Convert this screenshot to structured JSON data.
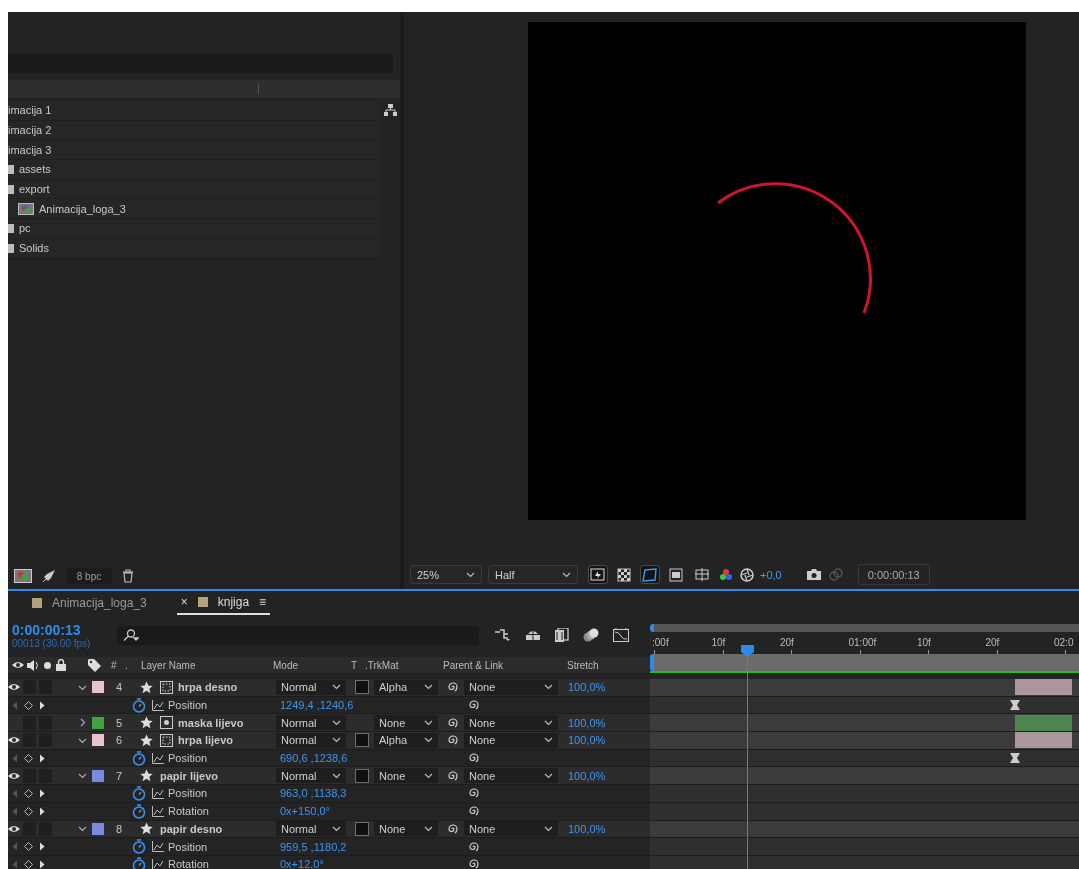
{
  "project": {
    "items": [
      {
        "label": "imacija 1",
        "kind": "plain"
      },
      {
        "label": "imacija 2",
        "kind": "plain"
      },
      {
        "label": "imacija 3",
        "kind": "plain"
      },
      {
        "label": "assets",
        "kind": "folder"
      },
      {
        "label": "export",
        "kind": "folder",
        "children": [
          {
            "label": "Animacija_loga_3",
            "kind": "composition"
          }
        ]
      },
      {
        "label": "pc",
        "kind": "folder"
      },
      {
        "label": "Solids",
        "kind": "folder"
      }
    ],
    "bit_depth": "8 bpc"
  },
  "viewer": {
    "zoom": "25%",
    "resolution": "Half",
    "exposure": "+0,0",
    "timecode": "0:00:00:13",
    "toggles": [
      {
        "kind": "fast-previews",
        "on": true
      },
      {
        "kind": "transparency-grid",
        "on": false
      },
      {
        "kind": "mask-path",
        "on": true
      },
      {
        "kind": "region-of-interest",
        "on": false
      },
      {
        "kind": "guides",
        "on": false
      }
    ]
  },
  "timeline": {
    "tabs": [
      {
        "label": "Animacija_loga_3",
        "color": "#b5a07c",
        "selected": false
      },
      {
        "close": "×",
        "label": "knjiga",
        "color": "#b5a07c",
        "selected": true,
        "menu": "≡"
      }
    ],
    "current_time": "0:00:00:13",
    "frame_info": "00013 (30.00 fps)",
    "columns": [
      "#",
      ".",
      "Layer Name",
      "Mode",
      "T",
      ".TrkMat",
      "Parent & Link",
      "Stretch"
    ],
    "ruler": [
      ":00f",
      "10f",
      "20f",
      "01:00f",
      "10f",
      "20f",
      "02:0"
    ],
    "layers": [
      {
        "number": "4",
        "name": "hrpa desno",
        "color": "#e8c2cf",
        "visible": true,
        "expanded": true,
        "kind": "shape",
        "mode": "Normal",
        "matte_box": true,
        "trkmat": "Alpha",
        "parent": "None",
        "stretch": "100,0%",
        "bar_visible": true,
        "properties": [
          {
            "name": "Position",
            "value": "1249,4 ,1240,6",
            "keyframe": true
          }
        ]
      },
      {
        "number": "5",
        "name": "maska lijevo",
        "color": "#3fa33f",
        "visible": false,
        "expanded": false,
        "kind": "mask",
        "mode": "Normal",
        "matte_box": false,
        "trkmat": "None",
        "parent": "None",
        "stretch": "100,0%",
        "bar_visible": true
      },
      {
        "number": "6",
        "name": "hrpa lijevo",
        "color": "#e8c2cf",
        "visible": true,
        "expanded": true,
        "kind": "shape",
        "mode": "Normal",
        "matte_box": true,
        "trkmat": "Alpha",
        "parent": "None",
        "stretch": "100,0%",
        "bar_visible": true,
        "properties": [
          {
            "name": "Position",
            "value": "690,6 ,1238,6",
            "keyframe": true
          }
        ]
      },
      {
        "number": "7",
        "name": "papir lijevo",
        "color": "#7a8ae0",
        "visible": true,
        "expanded": true,
        "kind": "plain",
        "mode": "Normal",
        "matte_box": true,
        "trkmat": "None",
        "parent": "None",
        "stretch": "100,0%",
        "bar_visible": false,
        "properties": [
          {
            "name": "Position",
            "value": "963,0 ,1138,3",
            "keyframe": false
          },
          {
            "name": "Rotation",
            "value": "0x+150,0°",
            "keyframe": false
          }
        ]
      },
      {
        "number": "8",
        "name": "papir desno",
        "color": "#7a8ae0",
        "visible": true,
        "expanded": true,
        "kind": "plain",
        "mode": "Normal",
        "matte_box": true,
        "trkmat": "None",
        "parent": "None",
        "stretch": "100,0%",
        "bar_visible": false,
        "properties": [
          {
            "name": "Position",
            "value": "959,5 ,1180,2",
            "keyframe": false
          },
          {
            "name": "Rotation",
            "value": "0x+12,0°",
            "keyframe": false
          }
        ]
      }
    ]
  }
}
